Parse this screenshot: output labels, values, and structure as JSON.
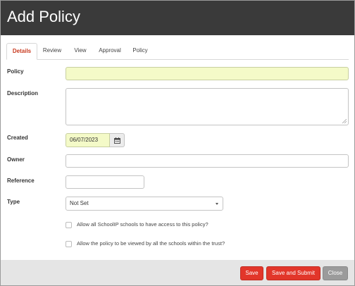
{
  "header": {
    "title": "Add Policy"
  },
  "tabs": [
    {
      "label": "Details",
      "active": true
    },
    {
      "label": "Review",
      "active": false
    },
    {
      "label": "View",
      "active": false
    },
    {
      "label": "Approval",
      "active": false
    },
    {
      "label": "Policy",
      "active": false
    }
  ],
  "form": {
    "policy": {
      "label": "Policy",
      "value": ""
    },
    "description": {
      "label": "Description",
      "value": ""
    },
    "created": {
      "label": "Created",
      "value": "06/07/2023"
    },
    "owner": {
      "label": "Owner",
      "value": ""
    },
    "reference": {
      "label": "Reference",
      "value": ""
    },
    "type": {
      "label": "Type",
      "value": "Not Set"
    },
    "checkbox_all_schools": {
      "label": "Allow all SchoolIP schools to have access to this policy?",
      "checked": false
    },
    "checkbox_trust": {
      "label": "Allow the policy to be viewed by all the schools within the trust?",
      "checked": false
    }
  },
  "footer": {
    "save_label": "Save",
    "save_submit_label": "Save and Submit",
    "close_label": "Close"
  },
  "colors": {
    "header_bg": "#3a3a3a",
    "active_tab": "#c8391e",
    "required_field_bg": "#f4fac8",
    "primary_button": "#e2362a",
    "secondary_button": "#9b9b9b",
    "footer_bg": "#e5e5e5"
  },
  "icons": {
    "date_picker": "calendar-icon",
    "select": "chevron-down-icon"
  }
}
